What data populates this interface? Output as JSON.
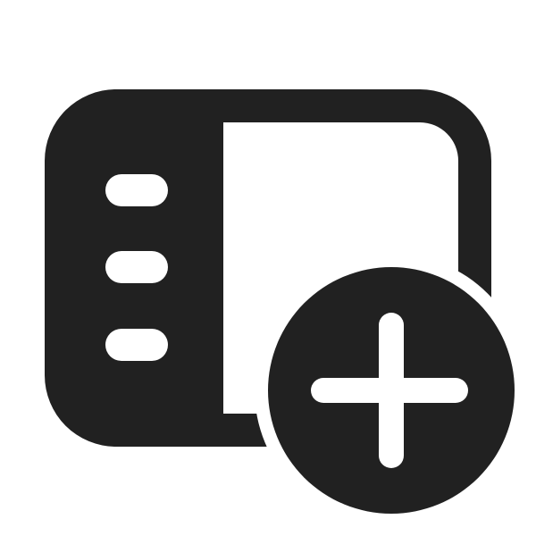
{
  "icon": {
    "name": "panel-left-add-icon",
    "description_colors": {
      "foreground": "#212121",
      "background": "#ffffff"
    }
  }
}
